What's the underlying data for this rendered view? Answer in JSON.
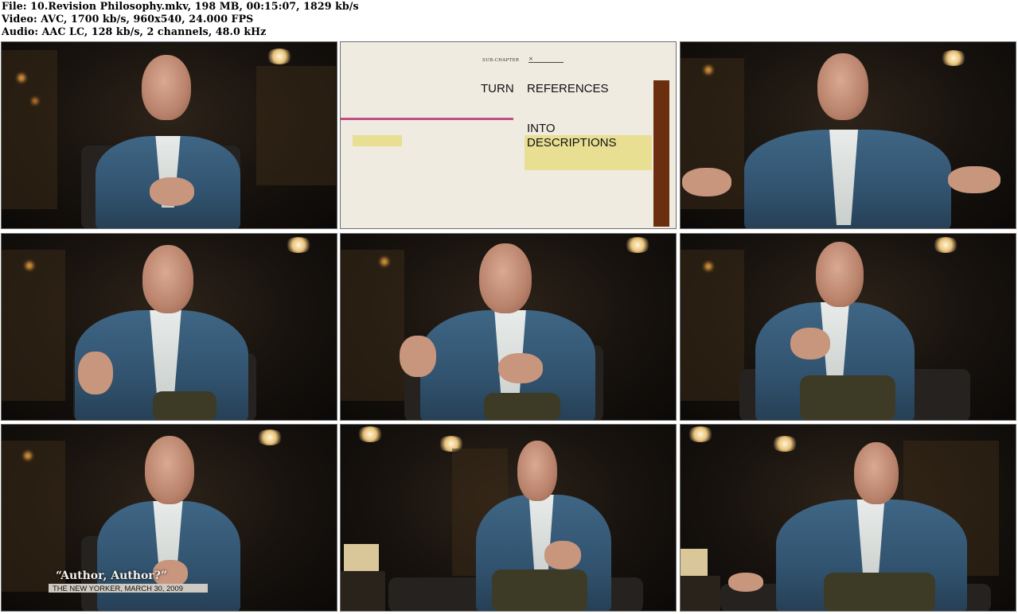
{
  "header": {
    "file_line": "File: 10.Revision Philosophy.mkv, 198 MB, 00:15:07, 1829 kb/s",
    "video_line": "Video: AVC, 1700 kb/s, 960x540, 24.000 FPS",
    "audio_line": "Audio: AAC LC, 128 kb/s, 2 channels, 48.0 kHz"
  },
  "title_card": {
    "sub_chapter": "SUB-CHAPTER",
    "x_mark": "×",
    "word_turn": "TURN",
    "word_references": "REFERENCES",
    "word_into": "INTO",
    "word_descriptions": "DESCRIPTIONS"
  },
  "caption": {
    "quote": "“Author, Author?”",
    "source": "THE NEW YORKER, MARCH 30, 2009"
  },
  "colors": {
    "jacket": "#3f6685",
    "card_background": "#efebe0",
    "card_pink": "#c24e86",
    "card_yellow": "#e8df93",
    "card_brown": "#6b2f10"
  }
}
